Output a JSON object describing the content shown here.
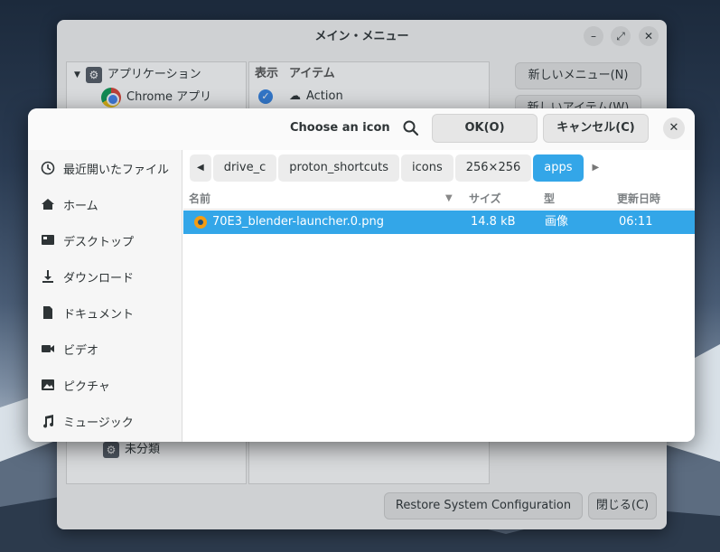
{
  "main_window": {
    "title": "メイン・メニュー",
    "tree": {
      "applications": "アプリケーション",
      "chrome_apps": "Chrome アプリ",
      "uncategorized": "未分類"
    },
    "items_columns": {
      "show": "表示",
      "item": "アイテム"
    },
    "items": [
      {
        "label": "Action",
        "shown": true
      }
    ],
    "new_menu_label": "新しいメニュー(N)",
    "new_item_label": "新しいアイテム(W)",
    "restore_label": "Restore System Configuration",
    "close_label": "閉じる(C)"
  },
  "dialog": {
    "title": "Choose an icon",
    "ok_label": "OK(O)",
    "cancel_label": "キャンセル(C)",
    "places": [
      {
        "label": "最近開いたファイル",
        "icon": "clock-icon"
      },
      {
        "label": "ホーム",
        "icon": "home-icon"
      },
      {
        "label": "デスクトップ",
        "icon": "desktop-icon"
      },
      {
        "label": "ダウンロード",
        "icon": "download-icon"
      },
      {
        "label": "ドキュメント",
        "icon": "document-icon"
      },
      {
        "label": "ビデオ",
        "icon": "video-icon"
      },
      {
        "label": "ピクチャ",
        "icon": "picture-icon"
      },
      {
        "label": "ミュージック",
        "icon": "music-icon"
      }
    ],
    "path": [
      "drive_c",
      "proton_shortcuts",
      "icons",
      "256×256",
      "apps"
    ],
    "columns": {
      "name": "名前",
      "size": "サイズ",
      "type": "型",
      "modified": "更新日時"
    },
    "files": [
      {
        "name": "70E3_blender-launcher.0.png",
        "size": "14.8 kB",
        "type": "画像",
        "modified": "06:11"
      }
    ]
  }
}
